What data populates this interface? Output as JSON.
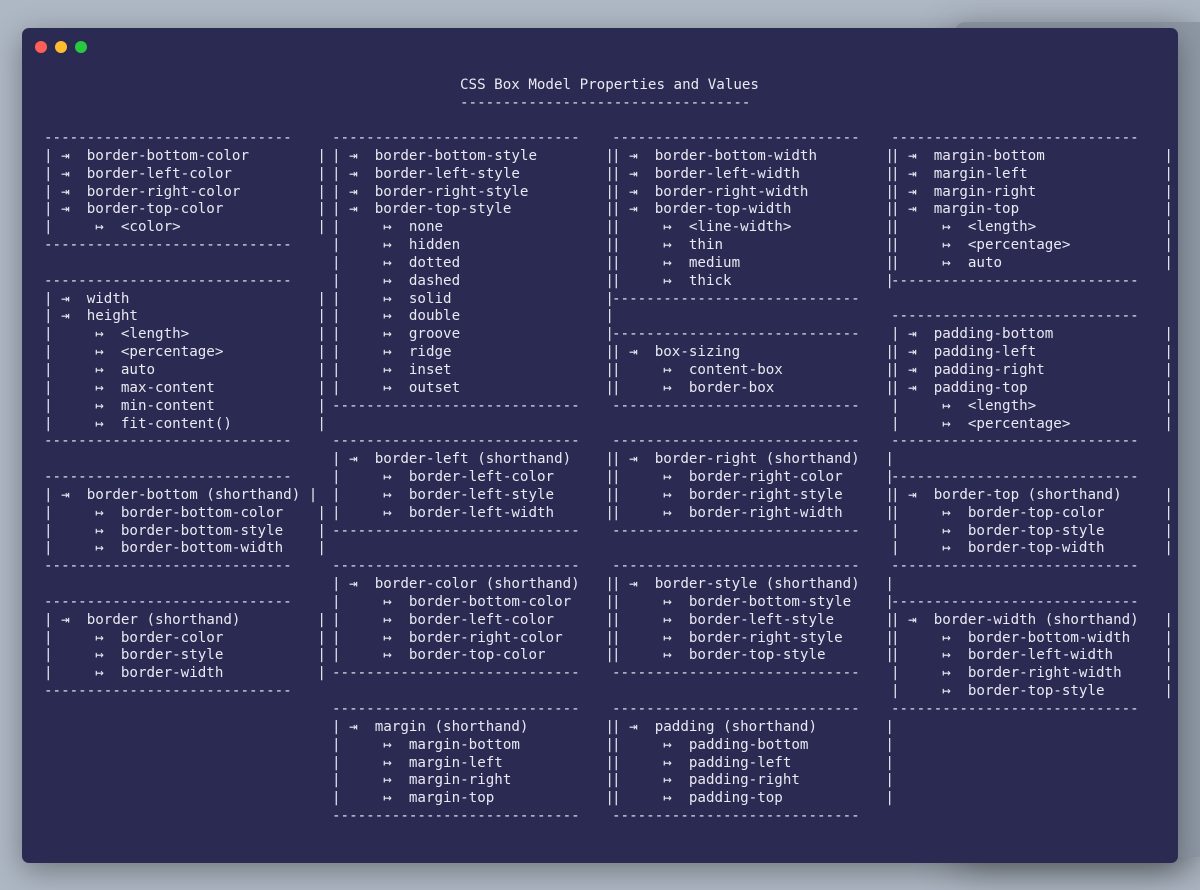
{
  "window": {
    "controls": {
      "close_color": "#ff5f57",
      "minimize_color": "#febc2e",
      "maximize_color": "#28c840"
    },
    "background": "#2b2a52",
    "text_color": "#e9e9f2"
  },
  "title": "CSS Box Model Properties and Values",
  "title_underline": "----------------------------------",
  "columns": [
    [
      "-----------------------------\n| ⇥  border-bottom-color        |\n| ⇥  border-left-color          |\n| ⇥  border-right-color         |\n| ⇥  border-top-color           |\n|     ↦  <color>                |\n-----------------------------",
      "",
      "-----------------------------\n| ⇥  width                      |\n| ⇥  height                     |\n|     ↦  <length>               |\n|     ↦  <percentage>           |\n|     ↦  auto                   |\n|     ↦  max-content            |\n|     ↦  min-content            |\n|     ↦  fit-content()          |\n-----------------------------",
      "",
      "-----------------------------\n| ⇥  border-bottom (shorthand) |\n|     ↦  border-bottom-color    |\n|     ↦  border-bottom-style    |\n|     ↦  border-bottom-width    |\n-----------------------------",
      "",
      "-----------------------------\n| ⇥  border (shorthand)         |\n|     ↦  border-color           |\n|     ↦  border-style           |\n|     ↦  border-width           |\n-----------------------------"
    ],
    [
      "-----------------------------\n| ⇥  border-bottom-style        |\n| ⇥  border-left-style          |\n| ⇥  border-right-style         |\n| ⇥  border-top-style           |\n|     ↦  none                   |\n|     ↦  hidden                 |\n|     ↦  dotted                 |\n|     ↦  dashed                 |\n|     ↦  solid                  |\n|     ↦  double                 |\n|     ↦  groove                 |\n|     ↦  ridge                  |\n|     ↦  inset                  |\n|     ↦  outset                 |\n-----------------------------",
      "",
      "-----------------------------\n| ⇥  border-left (shorthand)    |\n|     ↦  border-left-color      |\n|     ↦  border-left-style      |\n|     ↦  border-left-width      |\n-----------------------------",
      "",
      "-----------------------------\n| ⇥  border-color (shorthand)   |\n|     ↦  border-bottom-color    |\n|     ↦  border-left-color      |\n|     ↦  border-right-color     |\n|     ↦  border-top-color       |\n-----------------------------",
      "",
      "-----------------------------\n| ⇥  margin (shorthand)         |\n|     ↦  margin-bottom          |\n|     ↦  margin-left            |\n|     ↦  margin-right           |\n|     ↦  margin-top             |\n-----------------------------"
    ],
    [
      "-----------------------------\n| ⇥  border-bottom-width        |\n| ⇥  border-left-width          |\n| ⇥  border-right-width         |\n| ⇥  border-top-width           |\n|     ↦  <line-width>           |\n|     ↦  thin                   |\n|     ↦  medium                 |\n|     ↦  thick                  |\n-----------------------------",
      "",
      "-----------------------------\n| ⇥  box-sizing                 |\n|     ↦  content-box            |\n|     ↦  border-box             |\n-----------------------------",
      "",
      "-----------------------------\n| ⇥  border-right (shorthand)   |\n|     ↦  border-right-color     |\n|     ↦  border-right-style     |\n|     ↦  border-right-width     |\n-----------------------------",
      "",
      "-----------------------------\n| ⇥  border-style (shorthand)   |\n|     ↦  border-bottom-style    |\n|     ↦  border-left-style      |\n|     ↦  border-right-style     |\n|     ↦  border-top-style       |\n-----------------------------",
      "",
      "-----------------------------\n| ⇥  padding (shorthand)        |\n|     ↦  padding-bottom         |\n|     ↦  padding-left           |\n|     ↦  padding-right          |\n|     ↦  padding-top            |\n-----------------------------"
    ],
    [
      "-----------------------------\n| ⇥  margin-bottom              |\n| ⇥  margin-left                |\n| ⇥  margin-right               |\n| ⇥  margin-top                 |\n|     ↦  <length>               |\n|     ↦  <percentage>           |\n|     ↦  auto                   |\n-----------------------------",
      "",
      "-----------------------------\n| ⇥  padding-bottom             |\n| ⇥  padding-left               |\n| ⇥  padding-right              |\n| ⇥  padding-top                |\n|     ↦  <length>               |\n|     ↦  <percentage>           |\n-----------------------------",
      "",
      "-----------------------------\n| ⇥  border-top (shorthand)     |\n|     ↦  border-top-color       |\n|     ↦  border-top-style       |\n|     ↦  border-top-width       |\n-----------------------------",
      "",
      "-----------------------------\n| ⇥  border-width (shorthand)   |\n|     ↦  border-bottom-width    |\n|     ↦  border-left-width      |\n|     ↦  border-right-width     |\n|     ↦  border-top-style       |\n-----------------------------"
    ]
  ]
}
